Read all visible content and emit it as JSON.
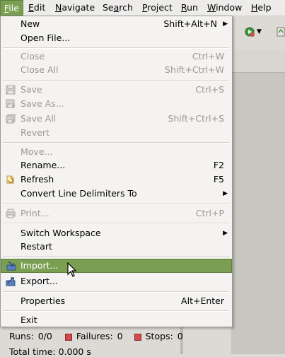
{
  "menubar": {
    "items": [
      {
        "label": "File",
        "mnemonic": "F",
        "rest": "ile"
      },
      {
        "label": "Edit",
        "mnemonic": "E",
        "rest": "dit"
      },
      {
        "label": "Navigate",
        "mnemonic": "N",
        "rest": "avigate"
      },
      {
        "label": "Search",
        "mnemonic": "a",
        "pre": "Se",
        "rest": "rch"
      },
      {
        "label": "Project",
        "mnemonic": "P",
        "rest": "roject"
      },
      {
        "label": "Run",
        "mnemonic": "R",
        "rest": "un"
      },
      {
        "label": "Window",
        "mnemonic": "W",
        "rest": "indow"
      },
      {
        "label": "Help",
        "mnemonic": "H",
        "rest": "elp"
      }
    ]
  },
  "file_menu": {
    "new": {
      "label": "New",
      "accel": "Shift+Alt+N"
    },
    "open_file": {
      "label": "Open File..."
    },
    "close": {
      "label": "Close",
      "accel": "Ctrl+W"
    },
    "close_all": {
      "label": "Close All",
      "accel": "Shift+Ctrl+W"
    },
    "save": {
      "label": "Save",
      "accel": "Ctrl+S"
    },
    "save_as": {
      "label": "Save As..."
    },
    "save_all": {
      "label": "Save All",
      "accel": "Shift+Ctrl+S"
    },
    "revert": {
      "label": "Revert"
    },
    "move": {
      "label": "Move..."
    },
    "rename": {
      "label": "Rename...",
      "accel": "F2"
    },
    "refresh": {
      "label": "Refresh",
      "accel": "F5"
    },
    "convert": {
      "label": "Convert Line Delimiters To"
    },
    "print": {
      "label": "Print...",
      "accel": "Ctrl+P"
    },
    "switch_workspace": {
      "label": "Switch Workspace"
    },
    "restart": {
      "label": "Restart"
    },
    "import": {
      "label": "Import..."
    },
    "export": {
      "label": "Export..."
    },
    "properties": {
      "label": "Properties",
      "accel": "Alt+Enter"
    },
    "exit": {
      "label": "Exit"
    }
  },
  "status": {
    "runs_label": "Runs:",
    "runs_value": "0/0",
    "failures_label": "Failures:",
    "failures_value": "0",
    "stops_label": "Stops:",
    "stops_value": "0",
    "total_time": "Total time: 0.000 s"
  },
  "colors": {
    "highlight": "#7a9f52",
    "menu_bg": "#f4f3f1",
    "disabled": "#9a9893"
  },
  "icons": [
    "save-icon",
    "save-as-icon",
    "save-all-icon",
    "refresh-icon",
    "print-icon",
    "import-icon",
    "export-icon",
    "submenu-arrow-icon",
    "mouse-pointer-icon"
  ]
}
